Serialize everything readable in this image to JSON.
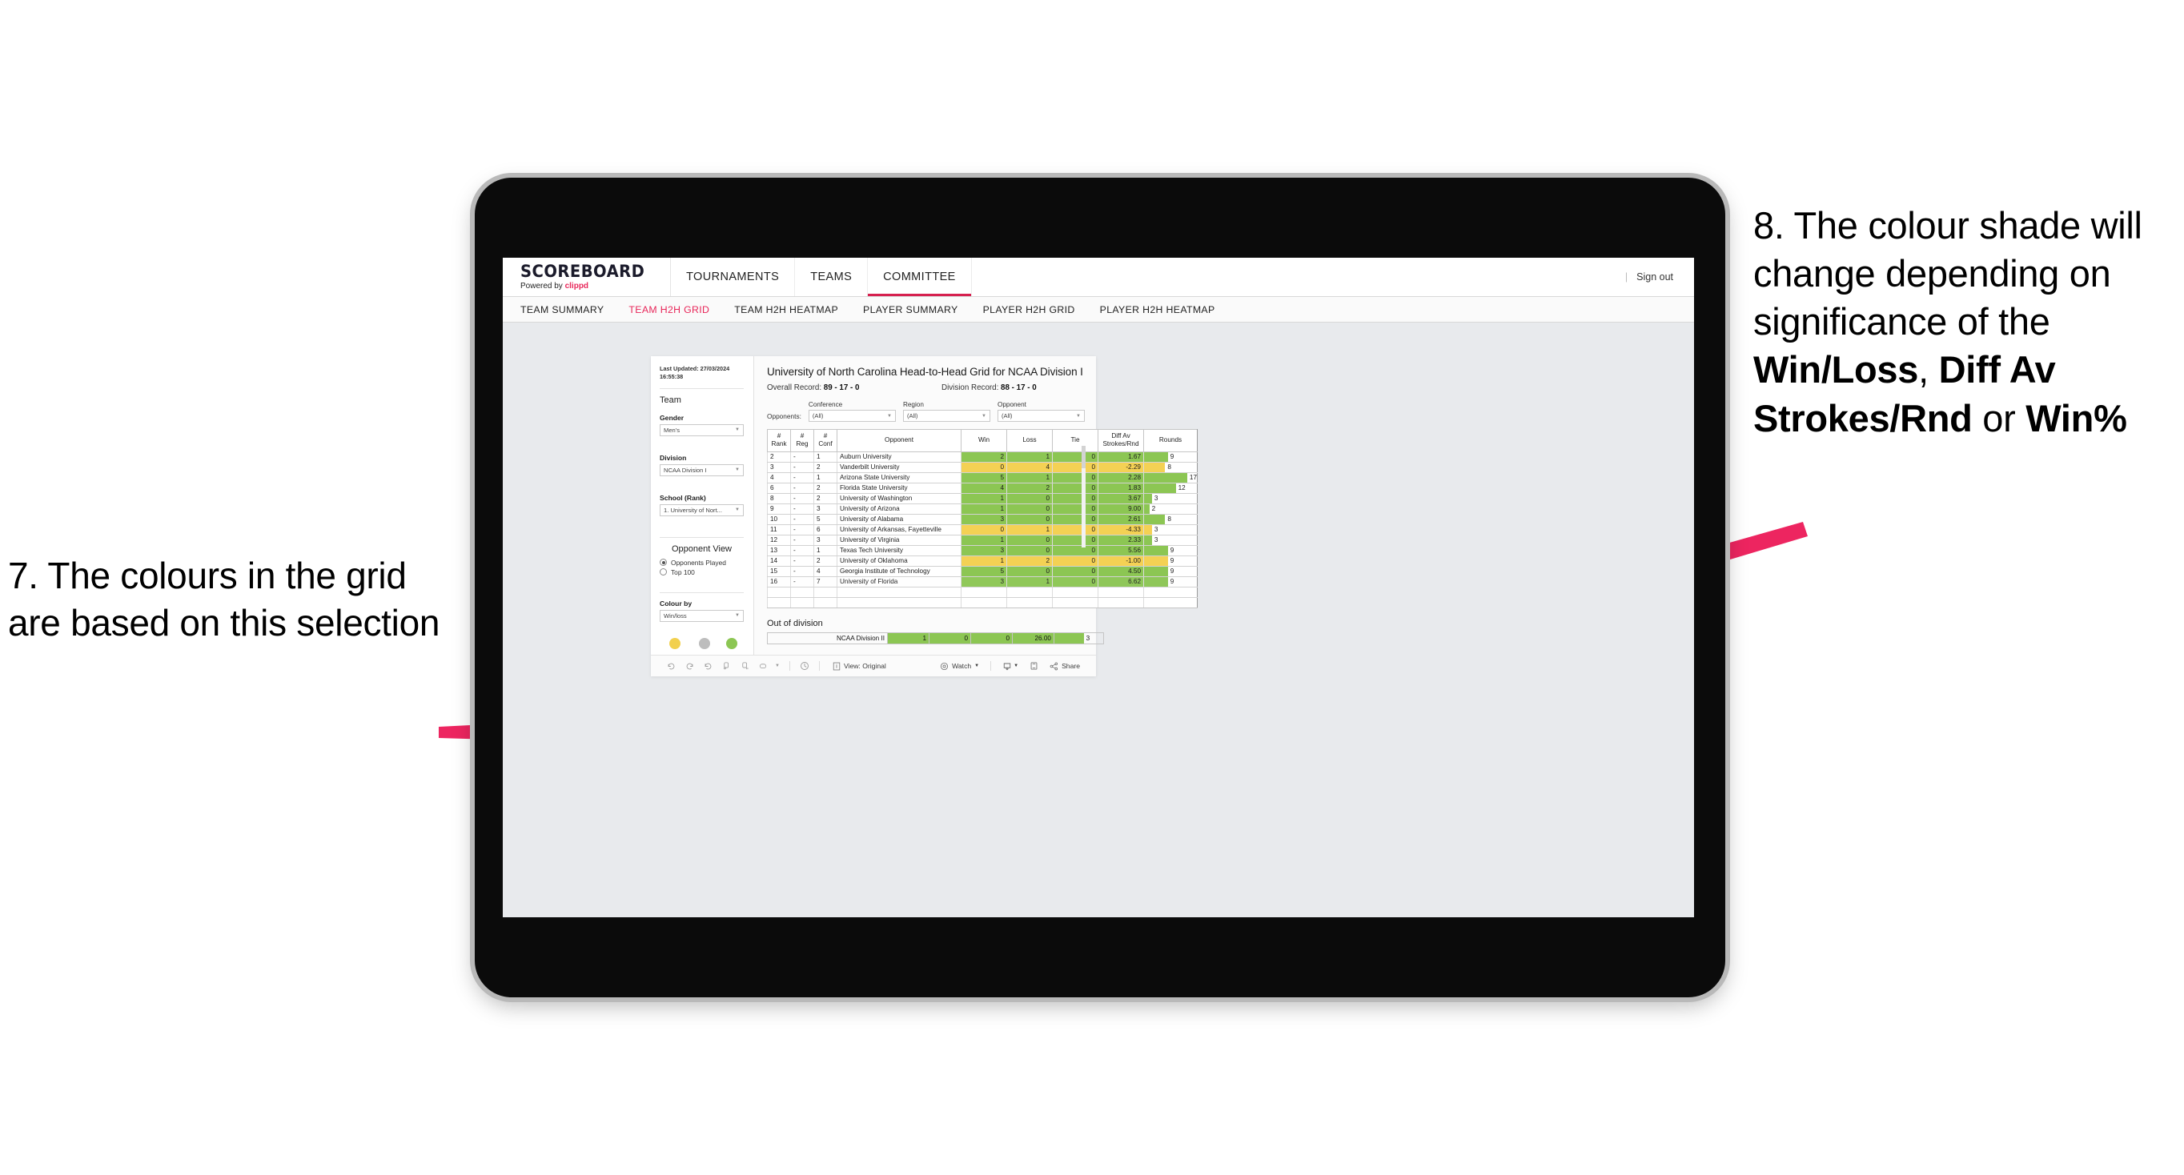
{
  "annotations": {
    "left": "7. The colours in the grid are based on this selection",
    "right_pre": "8. The colour shade will change depending on significance of the ",
    "right_b1": "Win/Loss",
    "right_mid1": ", ",
    "right_b2": "Diff Av Strokes/Rnd",
    "right_mid2": " or ",
    "right_b3": "Win%",
    "arrow_color": "#ED2560"
  },
  "app": {
    "brand": {
      "title": "SCOREBOARD",
      "powered_prefix": "Powered by ",
      "powered_name": "clippd"
    },
    "nav_tabs": [
      {
        "label": "TOURNAMENTS",
        "active": false
      },
      {
        "label": "TEAMS",
        "active": false
      },
      {
        "label": "COMMITTEE",
        "active": true
      }
    ],
    "top_right": {
      "divider": "|",
      "sign_out": "Sign out"
    },
    "sub_tabs": [
      {
        "label": "TEAM SUMMARY",
        "active": false
      },
      {
        "label": "TEAM H2H GRID",
        "active": true
      },
      {
        "label": "TEAM H2H HEATMAP",
        "active": false
      },
      {
        "label": "PLAYER SUMMARY",
        "active": false
      },
      {
        "label": "PLAYER H2H GRID",
        "active": false
      },
      {
        "label": "PLAYER H2H HEATMAP",
        "active": false
      }
    ]
  },
  "sidebar": {
    "last_updated": "Last Updated: 27/03/2024 16:55:38",
    "team_heading": "Team",
    "gender": {
      "label": "Gender",
      "value": "Men's"
    },
    "division": {
      "label": "Division",
      "value": "NCAA Division I"
    },
    "school": {
      "label": "School (Rank)",
      "value": "1. University of Nort..."
    },
    "opponent_view": {
      "heading": "Opponent View",
      "options": [
        {
          "label": "Opponents Played",
          "selected": true
        },
        {
          "label": "Top 100",
          "selected": false
        }
      ]
    },
    "colour_by": {
      "label": "Colour by",
      "value": "Win/loss"
    },
    "legend": [
      {
        "label": "Down",
        "color": "#F2D04E"
      },
      {
        "label": "Level",
        "color": "#BDBDBD"
      },
      {
        "label": "Up",
        "color": "#8CC653"
      }
    ]
  },
  "viz": {
    "title": "University of North Carolina Head-to-Head Grid for NCAA Division I",
    "overall_record_label": "Overall Record: ",
    "overall_record": "89 - 17 - 0",
    "division_record_label": "Division Record: ",
    "division_record": "88 - 17 - 0",
    "opponents_label": "Opponents:",
    "filters": [
      {
        "title": "Conference",
        "value": "(All)"
      },
      {
        "title": "Region",
        "value": "(All)"
      },
      {
        "title": "Opponent",
        "value": "(All)"
      }
    ],
    "columns": [
      "# Rank",
      "# Reg",
      "# Conf",
      "Opponent",
      "Win",
      "Loss",
      "Tie",
      "Diff Av Strokes/Rnd",
      "Rounds"
    ],
    "column_lines": [
      [
        "#",
        "Rank"
      ],
      [
        "#",
        "Reg"
      ],
      [
        "#",
        "Conf"
      ],
      [
        "",
        "Opponent"
      ],
      [
        "",
        "Win"
      ],
      [
        "",
        "Loss"
      ],
      [
        "",
        "Tie"
      ],
      [
        "Diff Av",
        "Strokes/Rnd"
      ],
      [
        "",
        "Rounds"
      ]
    ],
    "rounds_max": 20,
    "rows": [
      {
        "rank": "2",
        "reg": "-",
        "conf": "1",
        "opponent": "Auburn University",
        "win": "2",
        "loss": "1",
        "tie": "0",
        "diff": "1.67",
        "rounds": "9",
        "state": "win"
      },
      {
        "rank": "3",
        "reg": "-",
        "conf": "2",
        "opponent": "Vanderbilt University",
        "win": "0",
        "loss": "4",
        "tie": "0",
        "diff": "-2.29",
        "rounds": "8",
        "state": "loss"
      },
      {
        "rank": "4",
        "reg": "-",
        "conf": "1",
        "opponent": "Arizona State University",
        "win": "5",
        "loss": "1",
        "tie": "0",
        "diff": "2.28",
        "rounds": "17",
        "state": "win"
      },
      {
        "rank": "6",
        "reg": "-",
        "conf": "2",
        "opponent": "Florida State University",
        "win": "4",
        "loss": "2",
        "tie": "0",
        "diff": "1.83",
        "rounds": "12",
        "state": "win"
      },
      {
        "rank": "8",
        "reg": "-",
        "conf": "2",
        "opponent": "University of Washington",
        "win": "1",
        "loss": "0",
        "tie": "0",
        "diff": "3.67",
        "rounds": "3",
        "state": "win"
      },
      {
        "rank": "9",
        "reg": "-",
        "conf": "3",
        "opponent": "University of Arizona",
        "win": "1",
        "loss": "0",
        "tie": "0",
        "diff": "9.00",
        "rounds": "2",
        "state": "win"
      },
      {
        "rank": "10",
        "reg": "-",
        "conf": "5",
        "opponent": "University of Alabama",
        "win": "3",
        "loss": "0",
        "tie": "0",
        "diff": "2.61",
        "rounds": "8",
        "state": "win"
      },
      {
        "rank": "11",
        "reg": "-",
        "conf": "6",
        "opponent": "University of Arkansas, Fayetteville",
        "win": "0",
        "loss": "1",
        "tie": "0",
        "diff": "-4.33",
        "rounds": "3",
        "state": "loss"
      },
      {
        "rank": "12",
        "reg": "-",
        "conf": "3",
        "opponent": "University of Virginia",
        "win": "1",
        "loss": "0",
        "tie": "0",
        "diff": "2.33",
        "rounds": "3",
        "state": "win"
      },
      {
        "rank": "13",
        "reg": "-",
        "conf": "1",
        "opponent": "Texas Tech University",
        "win": "3",
        "loss": "0",
        "tie": "0",
        "diff": "5.56",
        "rounds": "9",
        "state": "win"
      },
      {
        "rank": "14",
        "reg": "-",
        "conf": "2",
        "opponent": "University of Oklahoma",
        "win": "1",
        "loss": "2",
        "tie": "0",
        "diff": "-1.00",
        "rounds": "9",
        "state": "loss"
      },
      {
        "rank": "15",
        "reg": "-",
        "conf": "4",
        "opponent": "Georgia Institute of Technology",
        "win": "5",
        "loss": "0",
        "tie": "0",
        "diff": "4.50",
        "rounds": "9",
        "state": "win"
      },
      {
        "rank": "16",
        "reg": "-",
        "conf": "7",
        "opponent": "University of Florida",
        "win": "3",
        "loss": "1",
        "tie": "0",
        "diff": "6.62",
        "rounds": "9",
        "state": "win"
      }
    ],
    "out_of_division": {
      "heading": "Out of division",
      "row": {
        "opponent": "NCAA Division II",
        "win": "1",
        "loss": "0",
        "tie": "0",
        "diff": "26.00",
        "rounds": "3",
        "state": "win"
      }
    },
    "toolbar": {
      "view_label": "View: Original",
      "watch_label": "Watch",
      "share_label": "Share"
    },
    "colors": {
      "win": "#8CC653",
      "loss": "#F4D154",
      "accent": "#E8275A"
    }
  }
}
